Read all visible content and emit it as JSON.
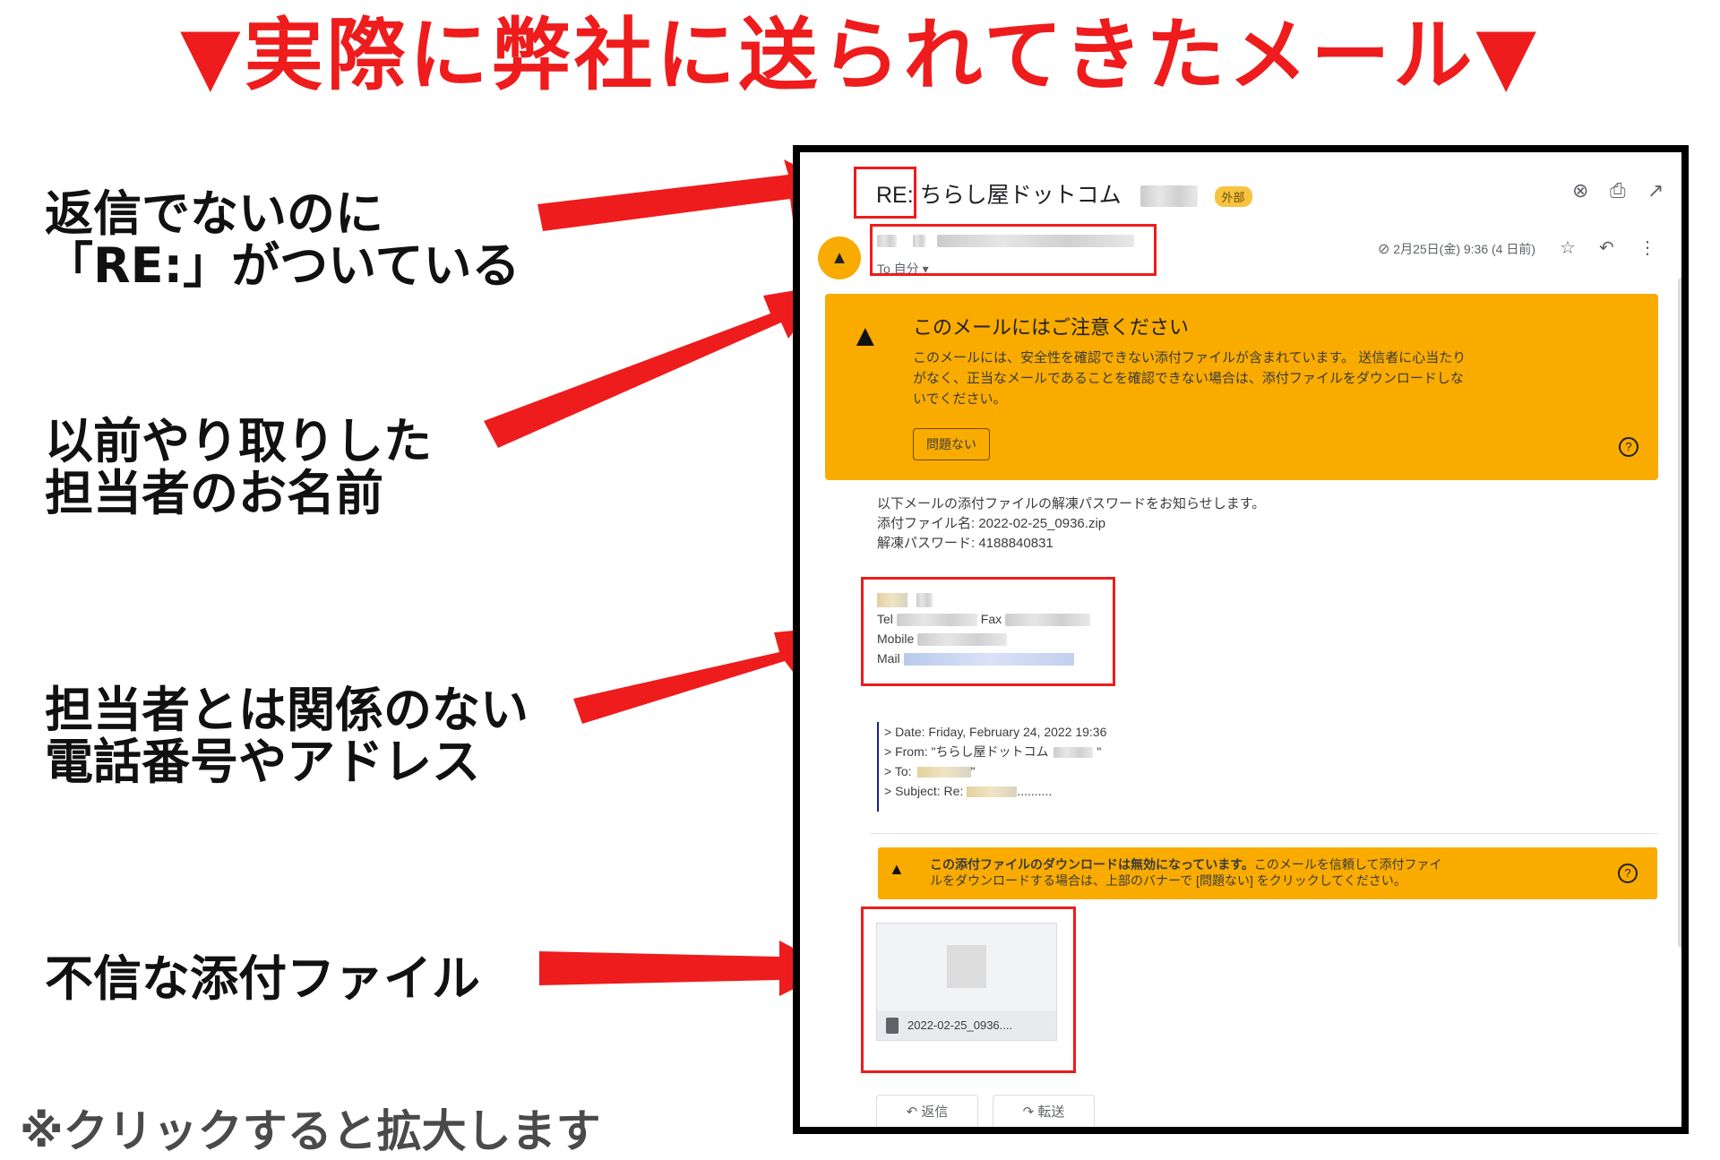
{
  "title": "▼実際に弊社に送られてきたメール▼",
  "notes": [
    {
      "lines": [
        "返信でないのに",
        "「RE:」がついている"
      ]
    },
    {
      "lines": [
        "以前やり取りした",
        "担当者のお名前"
      ]
    },
    {
      "lines": [
        "担当者とは関係のない",
        "電話番号やアドレス"
      ]
    },
    {
      "lines": [
        "不信な添付ファイル"
      ]
    }
  ],
  "footer": "※クリックすると拡大します",
  "colors": {
    "accent": "#ee1c1c",
    "warning": "#f9ab00"
  },
  "email": {
    "subject": "RE: ちらし屋ドットコム",
    "external_tag": "外部",
    "top_icons": [
      "close-circle-icon",
      "print-icon",
      "open-in-new-icon"
    ],
    "to_label": "To 自分",
    "date": "2月25日(金) 9:36 (4 日前)",
    "header_icons": [
      "attachment-icon",
      "star-icon",
      "reply-icon",
      "more-icon"
    ],
    "warning": {
      "title": "このメールにはご注意ください",
      "lines": [
        "このメールには、安全性を確認できない添付ファイルが含まれています。 送信者に心当たり",
        "がなく、正当なメールであることを確認できない場合は、添付ファイルをダウンロードしな",
        "いでください。"
      ],
      "button": "問題ない"
    },
    "body_lines": [
      "以下メールの添付ファイルの解凍パスワードをお知らせします。",
      "添付ファイル名: 2022-02-25_0936.zip",
      "解凍パスワード: 4188840831"
    ],
    "signature": {
      "tel": "Tel",
      "fax": "Fax",
      "mobile": "Mobile",
      "mail": "Mail"
    },
    "quote_lines": [
      "> Date: Friday, February 24, 2022 19:36",
      "> From: \"ちらし屋ドットコム",
      "> To:",
      "> Subject: Re:"
    ],
    "download_warning": {
      "bold": "この添付ファイルのダウンロードは無効になっています。",
      "line1": "このメールを信頼して添付ファイ",
      "line2": "ルをダウンロードする場合は、上部のバナーで [問題ない] をクリックしてください。"
    },
    "attachment_name": "2022-02-25_0936....",
    "reply_button": "返信",
    "forward_button": "転送"
  }
}
